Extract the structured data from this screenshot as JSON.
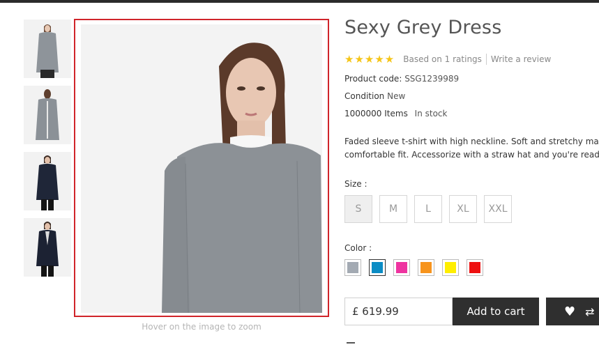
{
  "product": {
    "title": "Sexy Grey Dress",
    "rating_stars": "★★★★★",
    "rating_text": "Based on 1 ratings",
    "write_review": "Write a review",
    "product_code_label": "Product code:",
    "product_code": "SSG1239989",
    "condition_label": "Condition",
    "condition": "New",
    "stock_count": "1000000 Items",
    "stock_status": "In stock",
    "description_line1": "Faded sleeve t-shirt with high neckline. Soft and stretchy material for a",
    "description_line2": "comfortable fit. Accessorize with a straw hat and you're ready for summer!",
    "size_label": "Size :",
    "sizes": [
      "S",
      "M",
      "L",
      "XL",
      "XXL"
    ],
    "selected_size": "S",
    "color_label": "Color :",
    "colors": [
      "#a3aab3",
      "#0b8cc4",
      "#ee34a0",
      "#f7941d",
      "#ffee00",
      "#ee1111"
    ],
    "selected_color_index": 1,
    "price": "£ 619.99",
    "add_to_cart": "Add to cart"
  },
  "gallery": {
    "zoom_hint": "Hover on the image to zoom",
    "thumbnails": [
      "grey-sweater-front",
      "grey-sweater-back",
      "navy-blazer-front",
      "navy-blazer-open"
    ]
  },
  "icons": {
    "wishlist": "heart-icon",
    "compare": "compare-arrows-icon"
  }
}
